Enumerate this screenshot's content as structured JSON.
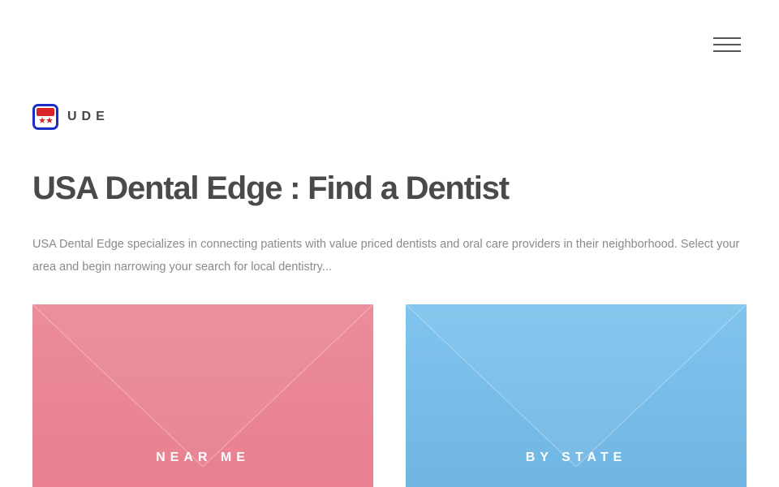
{
  "header": {
    "menu_icon": "hamburger-menu-icon"
  },
  "brand": {
    "logo_icon": "ude-logo-icon",
    "name": "UDE"
  },
  "main": {
    "title": "USA Dental Edge : Find a Dentist",
    "intro": "USA Dental Edge specializes in connecting patients with value priced dentists and oral care providers in their neighborhood. Select your area and begin narrowing your search for local dentistry..."
  },
  "cards": [
    {
      "label": "NEAR ME",
      "color": "#e8808f"
    },
    {
      "label": "BY STATE",
      "color": "#70b6e2"
    }
  ]
}
